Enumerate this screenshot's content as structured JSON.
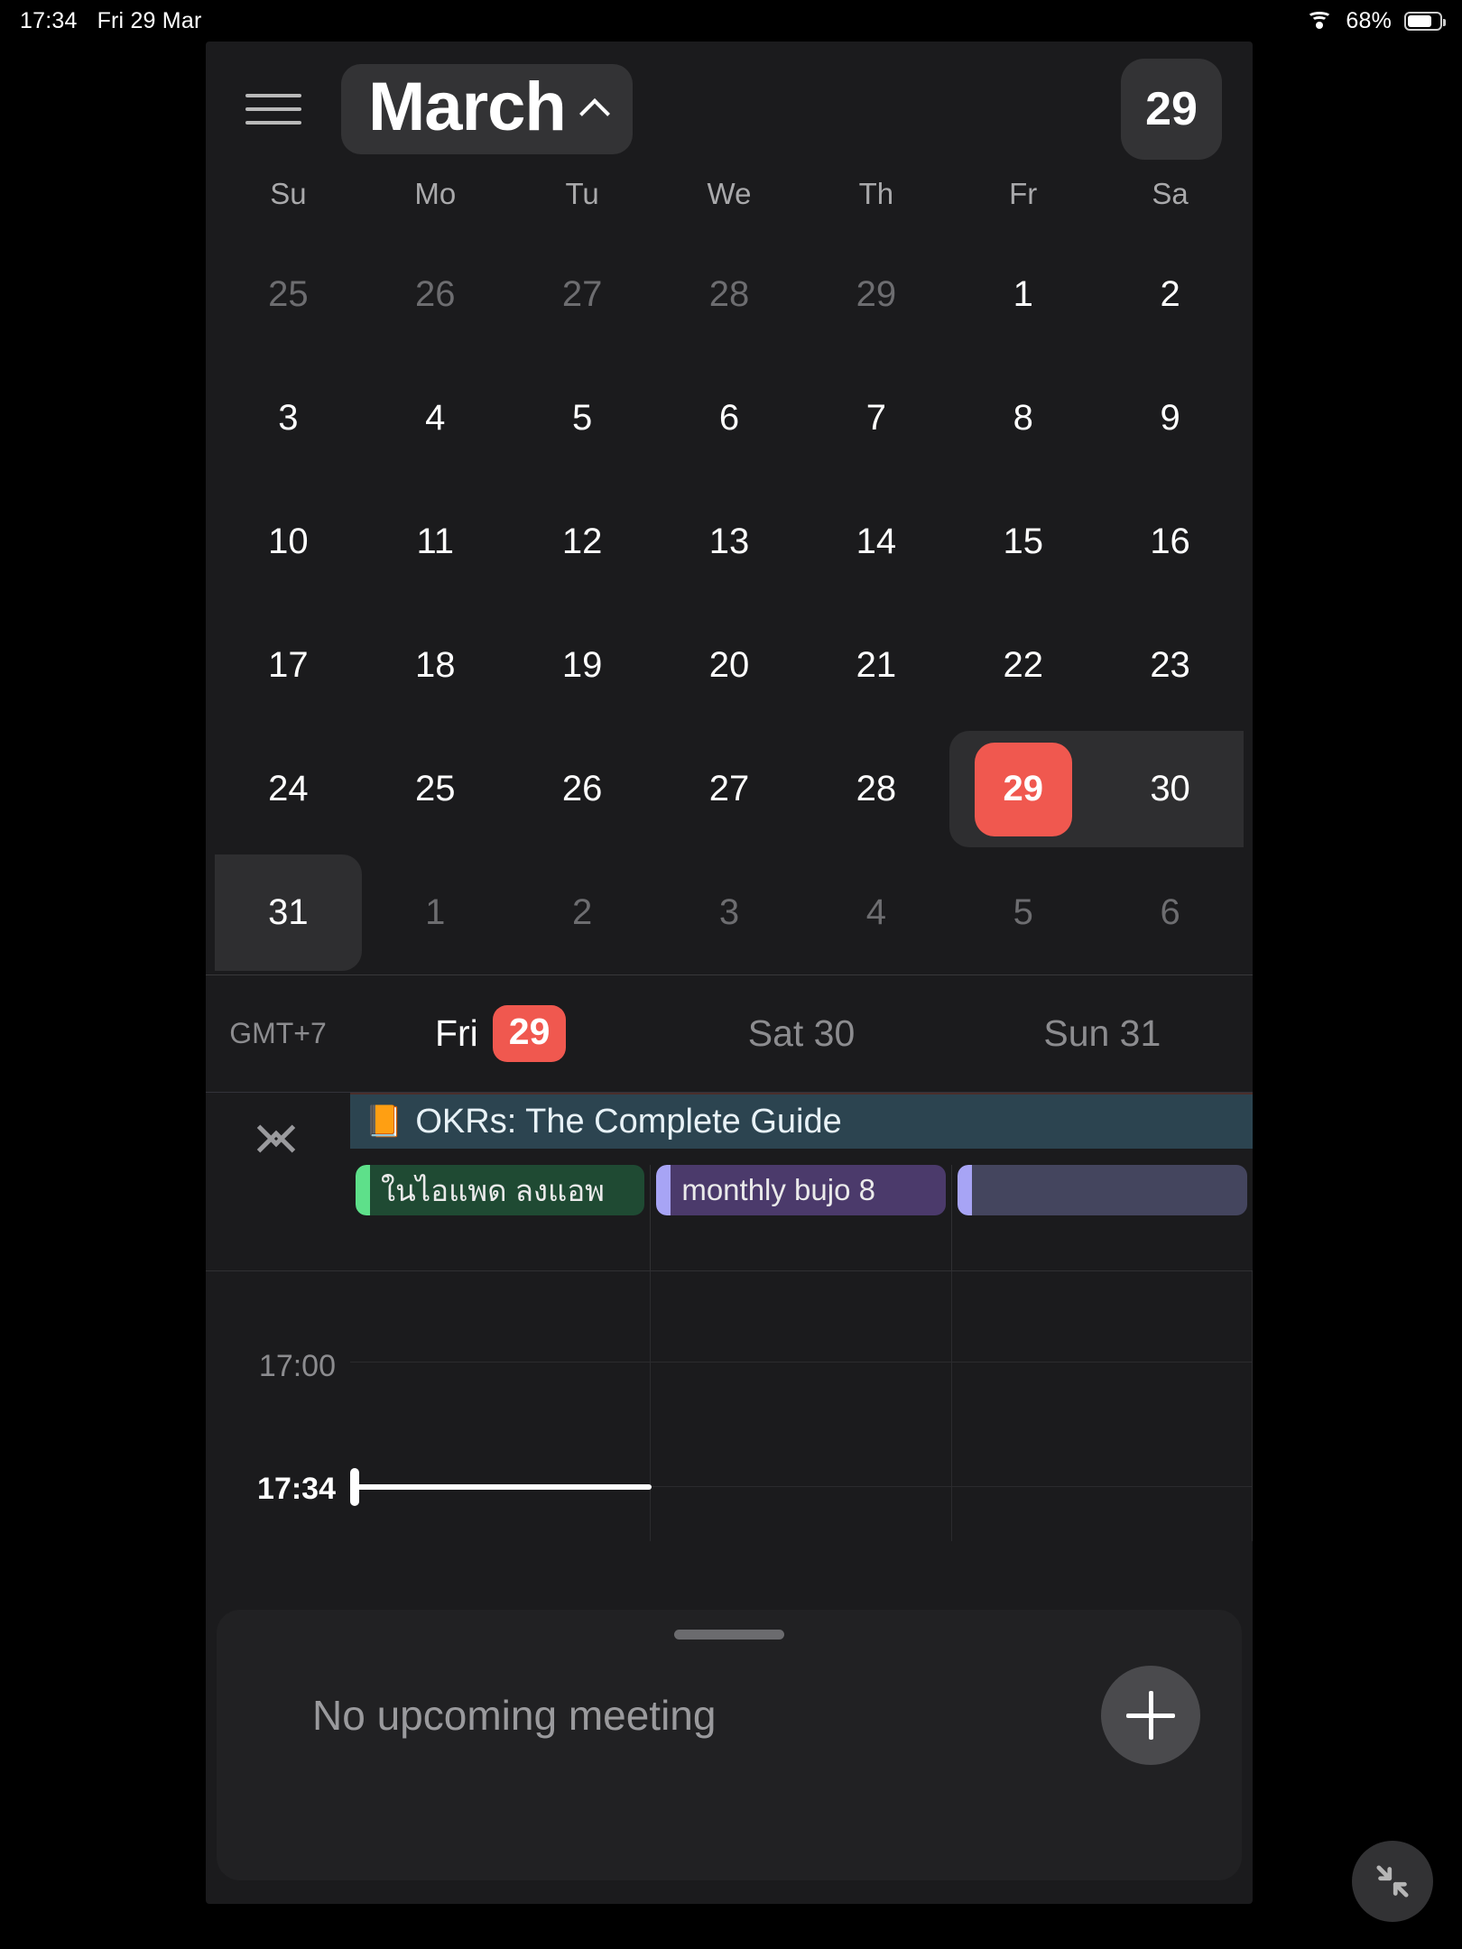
{
  "status_bar": {
    "time": "17:34",
    "date": "Fri 29 Mar",
    "wifi_icon": "wifi-icon",
    "battery_percent": "68%",
    "battery_icon": "battery-icon",
    "battery_level": 68
  },
  "header": {
    "menu_icon": "hamburger-menu-icon",
    "month": "March",
    "chevron_icon": "chevron-up-icon",
    "today_number": "29"
  },
  "calendar": {
    "weekdays": [
      "Su",
      "Mo",
      "Tu",
      "We",
      "Th",
      "Fr",
      "Sa"
    ],
    "weeks": [
      [
        {
          "d": "25",
          "dim": true
        },
        {
          "d": "26",
          "dim": true
        },
        {
          "d": "27",
          "dim": true
        },
        {
          "d": "28",
          "dim": true
        },
        {
          "d": "29",
          "dim": true
        },
        {
          "d": "1",
          "dim": false
        },
        {
          "d": "2",
          "dim": false
        }
      ],
      [
        {
          "d": "3",
          "dim": false
        },
        {
          "d": "4",
          "dim": false
        },
        {
          "d": "5",
          "dim": false
        },
        {
          "d": "6",
          "dim": false
        },
        {
          "d": "7",
          "dim": false
        },
        {
          "d": "8",
          "dim": false
        },
        {
          "d": "9",
          "dim": false
        }
      ],
      [
        {
          "d": "10",
          "dim": false
        },
        {
          "d": "11",
          "dim": false
        },
        {
          "d": "12",
          "dim": false
        },
        {
          "d": "13",
          "dim": false
        },
        {
          "d": "14",
          "dim": false
        },
        {
          "d": "15",
          "dim": false
        },
        {
          "d": "16",
          "dim": false
        }
      ],
      [
        {
          "d": "17",
          "dim": false
        },
        {
          "d": "18",
          "dim": false
        },
        {
          "d": "19",
          "dim": false
        },
        {
          "d": "20",
          "dim": false
        },
        {
          "d": "21",
          "dim": false
        },
        {
          "d": "22",
          "dim": false
        },
        {
          "d": "23",
          "dim": false
        }
      ],
      [
        {
          "d": "24",
          "dim": false
        },
        {
          "d": "25",
          "dim": false
        },
        {
          "d": "26",
          "dim": false
        },
        {
          "d": "27",
          "dim": false
        },
        {
          "d": "28",
          "dim": false
        },
        {
          "d": "29",
          "dim": false,
          "today": true
        },
        {
          "d": "30",
          "dim": false
        }
      ],
      [
        {
          "d": "31",
          "dim": false,
          "selected": true
        },
        {
          "d": "1",
          "dim": true
        },
        {
          "d": "2",
          "dim": true
        },
        {
          "d": "3",
          "dim": true
        },
        {
          "d": "4",
          "dim": true
        },
        {
          "d": "5",
          "dim": true
        },
        {
          "d": "6",
          "dim": true
        }
      ]
    ],
    "today_chip_color": "#f0584f",
    "selection_band_color": "#2e2e30"
  },
  "day_view": {
    "timezone": "GMT+7",
    "days": [
      {
        "label": "Fri",
        "pill": "29",
        "current": true
      },
      {
        "label": "Sat 30",
        "pill": "",
        "current": false
      },
      {
        "label": "Sun 31",
        "pill": "",
        "current": false
      }
    ],
    "collapse_icon": "collapse-chevrons-icon",
    "allday_event": {
      "emoji": "📙",
      "title": "OKRs: The Complete Guide",
      "background": "#2c4450"
    },
    "chips": [
      {
        "text": "ในไอแพด ลงแอพ",
        "bg": "#1f4a33",
        "bar": "#5ee08a"
      },
      {
        "text": "monthly bujo 8",
        "bg": "#4b3a6b",
        "bar": "#a7a4f5"
      },
      {
        "text": "",
        "bg": "#44455e",
        "bar": "#a7a4f5"
      }
    ],
    "hour_label": "17:00",
    "now_label": "17:34"
  },
  "sheet": {
    "grab_handle": "drag-handle",
    "empty_text": "No upcoming meeting",
    "add_icon": "plus-icon"
  },
  "floating": {
    "minimize_icon": "minimize-arrows-icon"
  }
}
